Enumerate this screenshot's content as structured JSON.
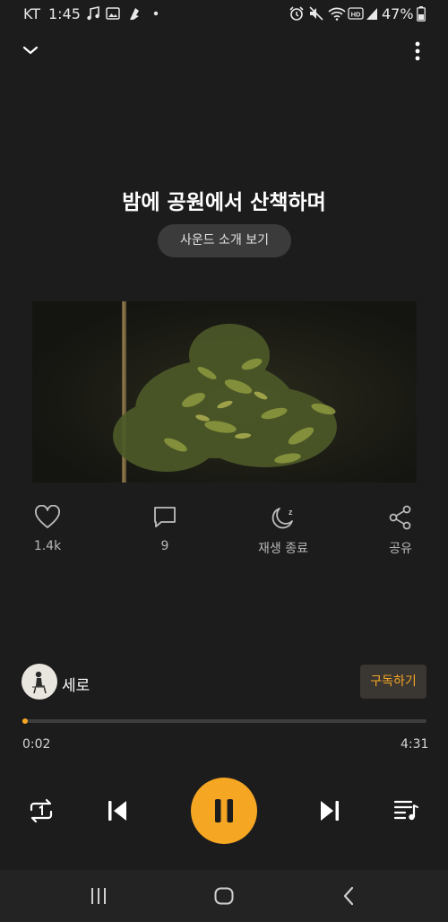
{
  "status_bar": {
    "carrier": "KT",
    "time": "1:45",
    "battery_percent": "47%",
    "icons": [
      "music-note-icon",
      "image-icon",
      "app-notification-icon",
      "dot-icon",
      "alarm-icon",
      "mute-icon",
      "wifi-icon",
      "hd-voice-icon",
      "signal-icon",
      "battery-icon"
    ]
  },
  "header": {
    "collapse_icon": "chevron-down-icon",
    "menu_icon": "more-vertical-icon"
  },
  "track": {
    "title": "밤에 공원에서 산책하며",
    "intro_button": "사운드 소개 보기"
  },
  "actions": {
    "like": {
      "icon": "heart-icon",
      "label": "1.4k"
    },
    "comment": {
      "icon": "comment-icon",
      "label": "9"
    },
    "sleep_timer": {
      "icon": "moon-icon",
      "label": "재생 종료"
    },
    "share": {
      "icon": "share-icon",
      "label": "공유"
    }
  },
  "artist": {
    "name": "세로",
    "subscribe_button": "구독하기"
  },
  "player": {
    "elapsed": "0:02",
    "total": "4:31",
    "progress_fraction": 0.007,
    "accent_color": "#f5a623",
    "controls": [
      "repeat-icon",
      "previous-icon",
      "pause-icon",
      "next-icon",
      "queue-icon"
    ]
  },
  "nav_bar": {
    "icons": [
      "recent-apps-icon",
      "home-icon",
      "back-icon"
    ]
  }
}
